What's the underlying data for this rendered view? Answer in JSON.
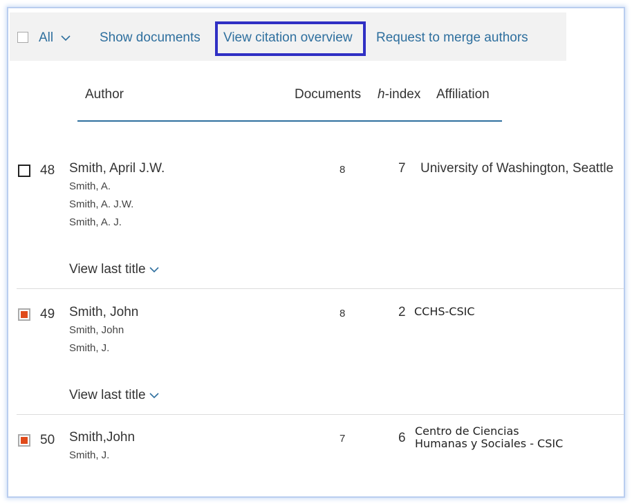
{
  "toolbar": {
    "select_all_label": "All",
    "show_documents": "Show documents",
    "view_citation_overview": "View citation overview",
    "request_merge": "Request to merge authors"
  },
  "table_header": {
    "author": "Author",
    "documents": "Documents",
    "h_index_italic": "h",
    "h_index_rest": "-index",
    "affiliation": "Affiliation"
  },
  "results": [
    {
      "number": "48",
      "name": "Smith, April J.W.",
      "variants": [
        "Smith, A.",
        "Smith, A. J.W.",
        "Smith, A. J."
      ],
      "documents": "8",
      "h_index": "7",
      "affiliation": "University of Washington, Seattle",
      "checked": false,
      "view_last_title": "View last title"
    },
    {
      "number": "49",
      "name": "Smith, John",
      "variants": [
        "Smith, John",
        "Smith, J."
      ],
      "documents": "8",
      "h_index": "2",
      "affiliation": "CCHS-CSIC",
      "checked": true,
      "view_last_title": "View last title"
    },
    {
      "number": "50",
      "name": "Smith,John",
      "variants": [
        "Smith, J."
      ],
      "documents": "7",
      "h_index": "6",
      "affiliation_line1": "Centro de Ciencias",
      "affiliation_line2": "Humanas y Sociales - CSIC",
      "checked": true
    }
  ],
  "colors": {
    "link": "#2e6f9e",
    "highlight_box": "#3030c4",
    "checkbox_fill": "#e04a1a",
    "toolbar_bg": "#f2f2f2"
  },
  "icons": {
    "dropdown": "chevron-down-icon",
    "checkbox": "checkbox-icon"
  }
}
